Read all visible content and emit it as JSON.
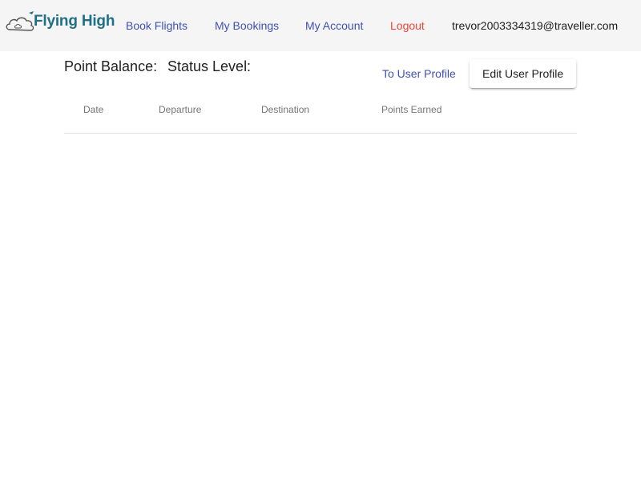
{
  "header": {
    "logo_text": "Flying High",
    "nav": {
      "book_flights": "Book Flights",
      "my_bookings": "My Bookings",
      "my_account": "My Account",
      "logout": "Logout"
    },
    "user_email": "trevor2003334319@traveller.com"
  },
  "main": {
    "point_balance_label": "Point Balance:",
    "status_level_label": "Status Level:",
    "to_user_profile_label": "To User Profile",
    "edit_user_profile_label": "Edit User Profile",
    "table": {
      "columns": [
        "Date",
        "Departure",
        "Destination",
        "Points Earned"
      ],
      "rows": []
    }
  },
  "colors": {
    "primary": "#3f51b5",
    "warn": "#f44336",
    "logo": "#1f6f86",
    "header_bg": "#f5f5f5"
  }
}
